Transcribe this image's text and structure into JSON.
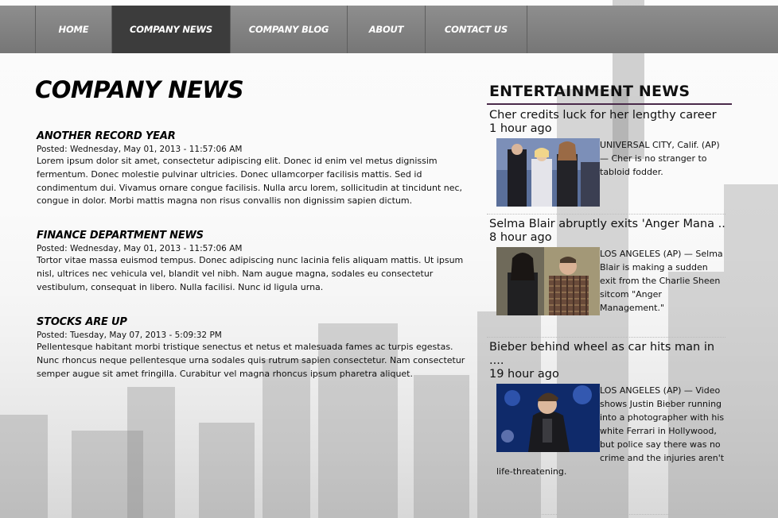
{
  "nav": {
    "items": [
      {
        "label": "HOME",
        "active": false
      },
      {
        "label": "COMPANY NEWS",
        "active": true
      },
      {
        "label": "COMPANY BLOG",
        "active": false
      },
      {
        "label": "ABOUT",
        "active": false
      },
      {
        "label": "CONTACT US",
        "active": false
      }
    ]
  },
  "main": {
    "title": "COMPANY NEWS",
    "articles": [
      {
        "title": "ANOTHER RECORD YEAR",
        "date": "Posted: Wednesday, May 01, 2013 - 11:57:06 AM",
        "body": "Lorem ipsum dolor sit amet, consectetur adipiscing elit. Donec id enim vel metus dignissim fermentum. Donec molestie pulvinar ultricies. Donec ullamcorper facilisis mattis. Sed id condimentum dui. Vivamus ornare congue facilisis. Nulla arcu lorem, sollicitudin at tincidunt nec, congue in dolor. Morbi mattis magna non risus convallis non dignissim sapien dictum."
      },
      {
        "title": "FINANCE DEPARTMENT NEWS",
        "date": "Posted: Wednesday, May 01, 2013 - 11:57:06 AM",
        "body": "Tortor vitae massa euismod tempus. Donec adipiscing nunc lacinia felis aliquam mattis. Ut ipsum nisl, ultrices nec vehicula vel, blandit vel nibh. Nam augue magna, sodales eu consectetur vestibulum, consequat in libero. Nulla facilisi. Nunc id ligula urna."
      },
      {
        "title": "STOCKS ARE UP",
        "date": "Posted: Tuesday, May 07, 2013 - 5:09:32 PM",
        "body": "Pellentesque habitant morbi tristique senectus et netus et malesuada fames ac turpis egestas. Nunc rhoncus neque pellentesque urna sodales quis rutrum sapien consectetur. Nam consectetur semper augue sit amet fringilla. Curabitur vel magna rhoncus ipsum pharetra aliquet."
      }
    ]
  },
  "sidebar": {
    "heading": "ENTERTAINMENT NEWS",
    "items": [
      {
        "headline": "Cher credits luck for her lengthy career",
        "time": "1 hour ago",
        "snippet": "UNIVERSAL CITY, Calif. (AP) — Cher is no stranger to tabloid fodder."
      },
      {
        "headline": "Selma Blair abruptly exits 'Anger Mana ....",
        "time": "8 hour ago",
        "snippet": "LOS ANGELES (AP) — Selma Blair is making a sudden exit from the Charlie Sheen sitcom \"Anger Management.\""
      },
      {
        "headline": "Bieber behind wheel as car hits man in",
        "headline_cont": "....",
        "time": "19 hour ago",
        "snippet": "LOS ANGELES (AP) — Video shows Justin Bieber running into a photographer with his white Ferrari in Hollywood, but police say there was no crime and the injuries aren't life-threatening."
      }
    ]
  }
}
